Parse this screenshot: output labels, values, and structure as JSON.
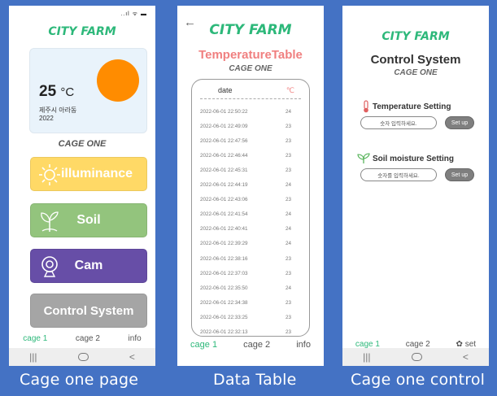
{
  "screen1": {
    "status": "..ıl ᯤ ▬",
    "brand": "CITY FARM",
    "weather": {
      "temp": "25",
      "unit": "°C",
      "location": "제주시 아라동",
      "year": "2022"
    },
    "cage_label": "CAGE ONE",
    "buttons": {
      "illuminance": "illuminance",
      "soil": "Soil",
      "cam": "Cam",
      "control": "Control System"
    },
    "nav": [
      "cage 1",
      "cage 2",
      "info"
    ],
    "caption": "Cage one page"
  },
  "screen2": {
    "brand": "CITY FARM",
    "title": "TemperatureTable",
    "subtitle": "CAGE ONE",
    "headers": [
      "date",
      "℃"
    ],
    "rows": [
      [
        "2022-06-01 22:50:22",
        "24"
      ],
      [
        "2022-06-01 22:49:09",
        "23"
      ],
      [
        "2022-06-01 22:47:56",
        "23"
      ],
      [
        "2022-06-01 22:46:44",
        "23"
      ],
      [
        "2022-06-01 22:45:31",
        "23"
      ],
      [
        "2022-06-01 22:44:19",
        "24"
      ],
      [
        "2022-06-01 22:43:06",
        "23"
      ],
      [
        "2022-06-01 22:41:54",
        "24"
      ],
      [
        "2022-06-01 22:40:41",
        "24"
      ],
      [
        "2022-06-01 22:39:29",
        "24"
      ],
      [
        "2022-06-01 22:38:16",
        "23"
      ],
      [
        "2022-06-01 22:37:03",
        "23"
      ],
      [
        "2022-06-01 22:35:50",
        "24"
      ],
      [
        "2022-06-01 22:34:38",
        "23"
      ],
      [
        "2022-06-01 22:33:25",
        "23"
      ],
      [
        "2022-06-01 22:32:13",
        "23"
      ]
    ],
    "nav": [
      "cage 1",
      "cage 2",
      "info"
    ],
    "caption": "Data Table"
  },
  "screen3": {
    "brand": "CITY FARM",
    "title": "Control System",
    "subtitle": "CAGE ONE",
    "temp_label": "Temperature Setting",
    "temp_placeholder": "숫자 입력하세요.",
    "soil_label": "Soil moisture Setting",
    "soil_placeholder": "숫자를 입력하세요.",
    "setup": "Set up",
    "nav": [
      "cage 1",
      "cage 2",
      "set"
    ],
    "caption": "Cage one control"
  },
  "icons": [
    "sun-icon",
    "sprout-icon",
    "webcam-icon",
    "thermometer-icon",
    "leaf-icon",
    "gear-icon",
    "back-arrow-icon"
  ],
  "colors": {
    "brand": "#2db87a",
    "sun": "#ff8c00",
    "illuminance": "#ffd966",
    "soil": "#93c47d",
    "cam": "#674ea7",
    "control": "#a5a5a5",
    "table_title": "#f08080",
    "background": "#4472c4"
  }
}
